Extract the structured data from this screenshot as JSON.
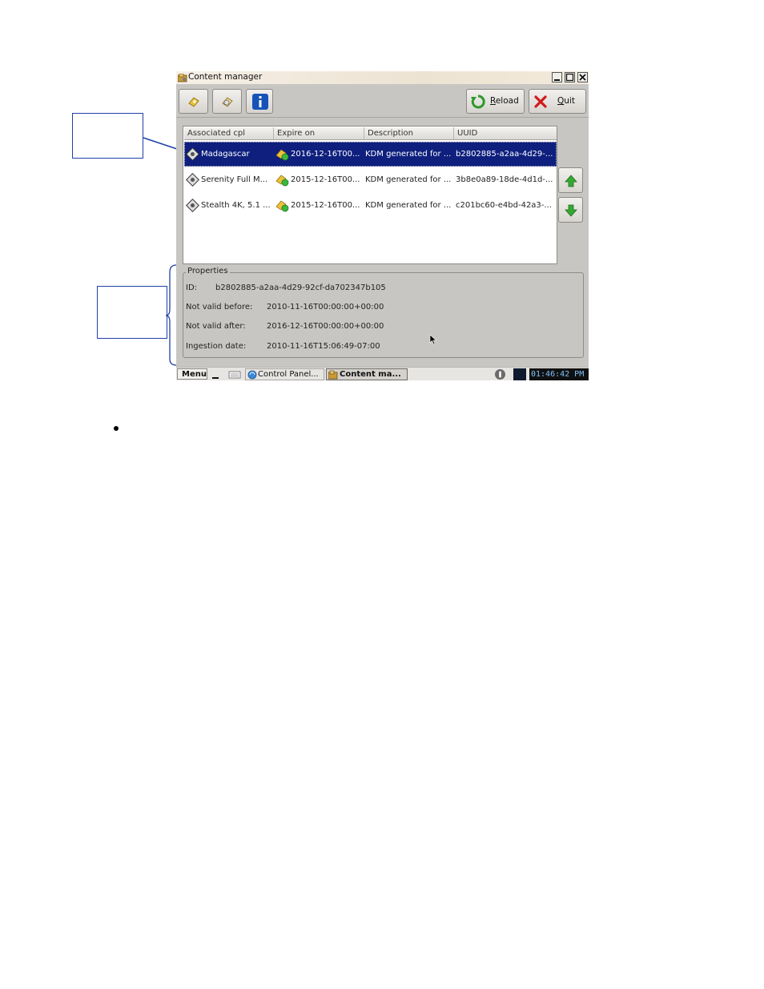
{
  "window": {
    "title": "Content manager",
    "app_icon": "content-manager-icon",
    "controls": [
      "minimize-icon",
      "maximize-icon",
      "close-icon"
    ]
  },
  "toolbar": {
    "buttons": [
      {
        "name": "kdm-import-button",
        "icon": "key-import-icon"
      },
      {
        "name": "kdm-delete-button",
        "icon": "key-delete-icon"
      },
      {
        "name": "info-button",
        "icon": "info-icon"
      }
    ],
    "reload_label": "Reload",
    "quit_label": "Quit",
    "reload_icon": "reload-icon",
    "quit_icon": "quit-icon"
  },
  "table": {
    "columns": [
      "Associated cpl",
      "Expire on",
      "Description",
      "UUID"
    ],
    "rows": [
      {
        "cpl": "Madagascar",
        "expire": "2016-12-16T00...",
        "description": "KDM generated for ...",
        "uuid": "b2802885-a2aa-4d29-...",
        "selected": true
      },
      {
        "cpl": "Serenity Full M...",
        "expire": "2015-12-16T00...",
        "description": "KDM generated for ...",
        "uuid": "3b8e0a89-18de-4d1d-...",
        "selected": false
      },
      {
        "cpl": "Stealth 4K, 5.1 ...",
        "expire": "2015-12-16T00...",
        "description": "KDM generated for ...",
        "uuid": "c201bc60-e4bd-42a3-...",
        "selected": false
      }
    ]
  },
  "side_buttons": {
    "up_icon": "arrow-up-icon",
    "down_icon": "arrow-down-icon"
  },
  "properties": {
    "legend": "Properties",
    "id_label": "ID:",
    "id_value": "b2802885-a2aa-4d29-92cf-da702347b105",
    "not_valid_before_label": "Not valid before:",
    "not_valid_before_value": "2010-11-16T00:00:00+00:00",
    "not_valid_after_label": "Not valid after:",
    "not_valid_after_value": "2016-12-16T00:00:00+00:00",
    "ingestion_date_label": "Ingestion date:",
    "ingestion_date_value": "2010-11-16T15:06:49-07:00"
  },
  "taskbar": {
    "menu_label": "Menu",
    "items": [
      "Control Panel...",
      "Content ma..."
    ],
    "clock": "01:46:42 PM"
  },
  "colors": {
    "selection": "#0e1f7e",
    "annotation": "#1f3fa8",
    "window_bg": "#c8c6c3"
  }
}
